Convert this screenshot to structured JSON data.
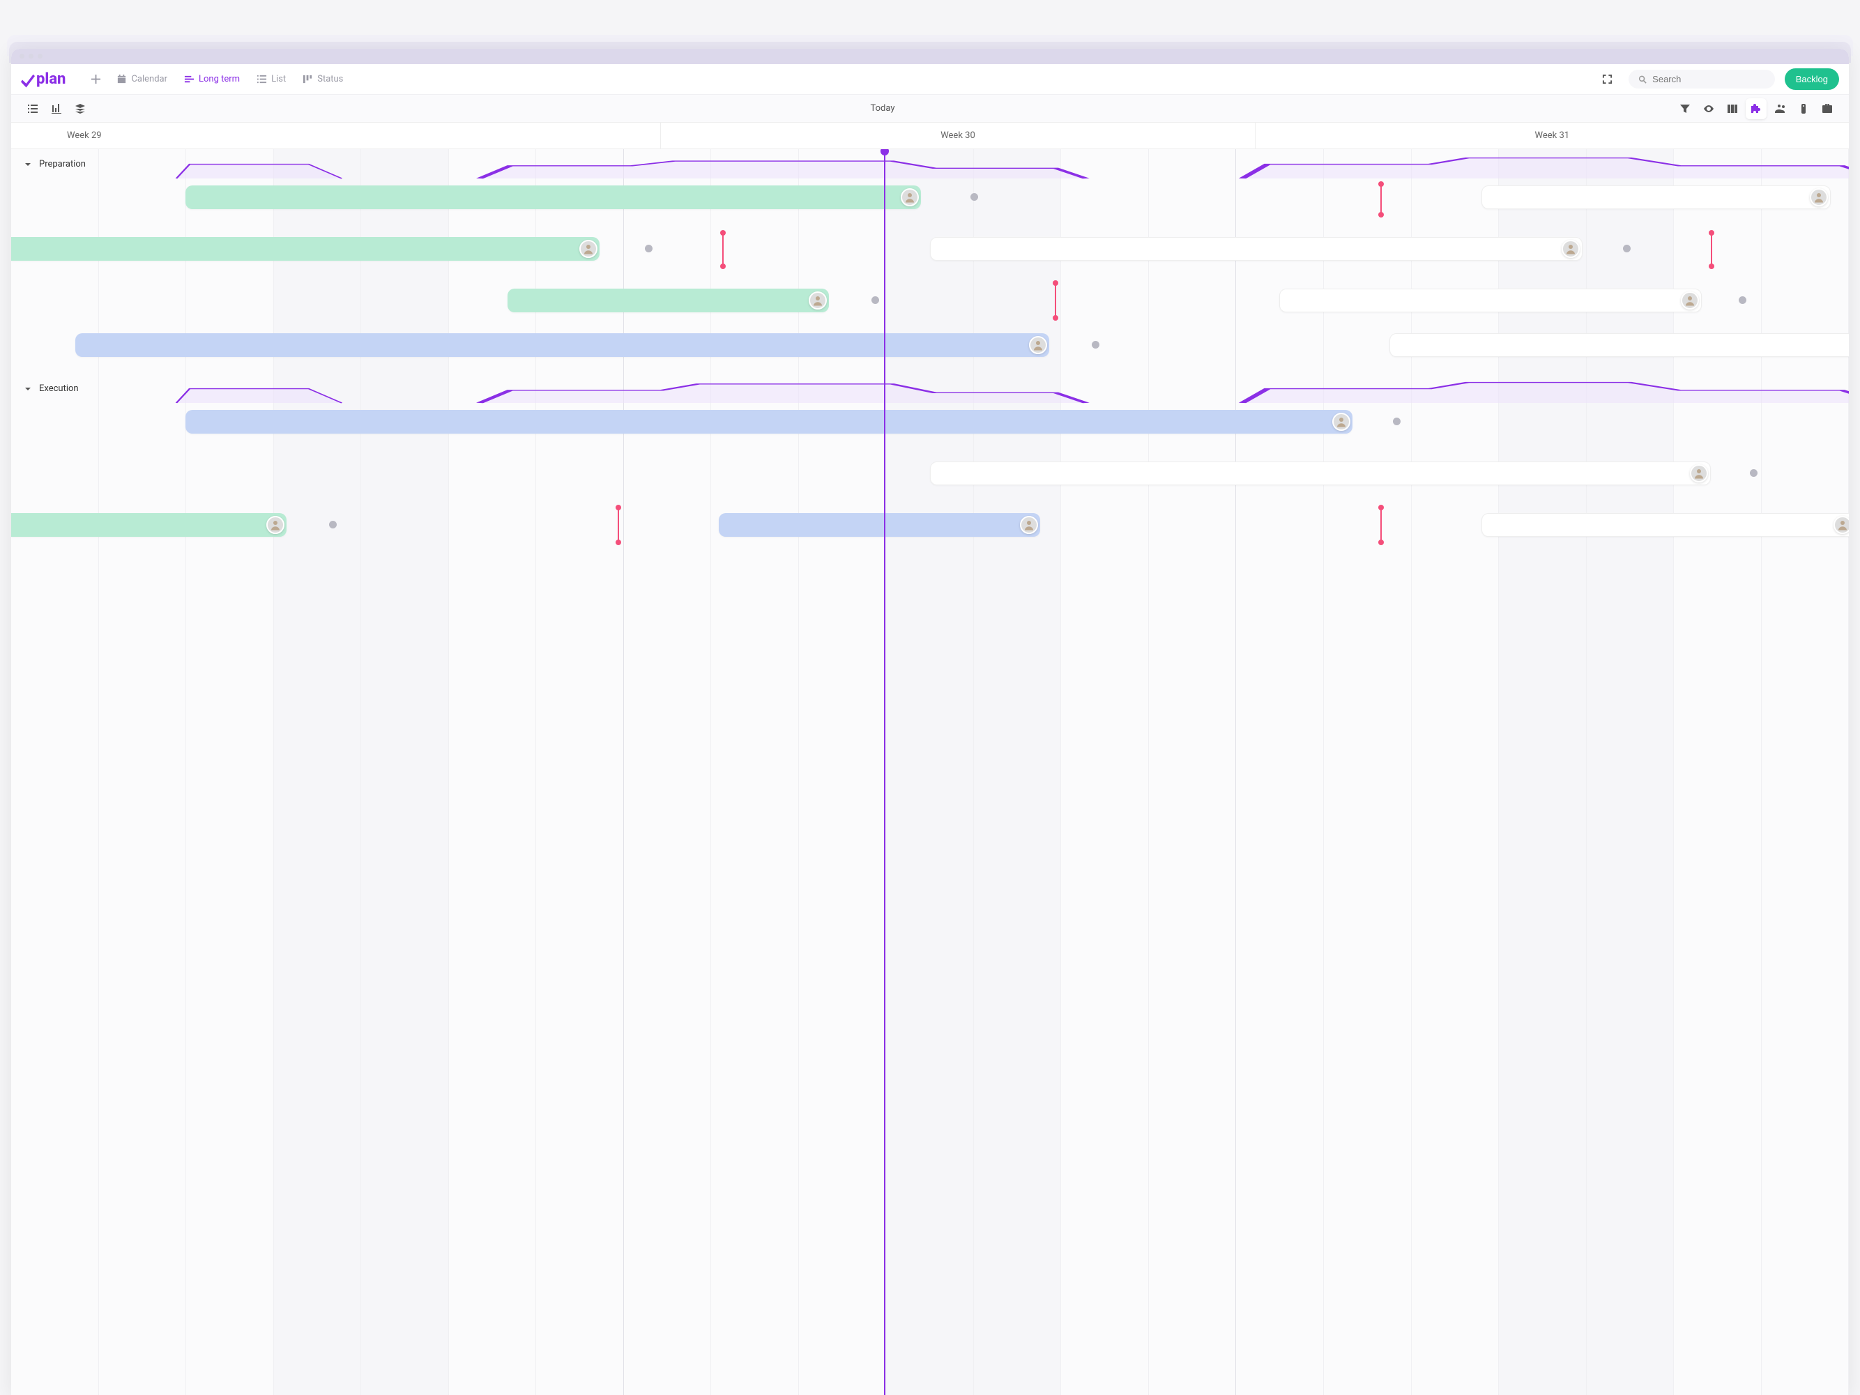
{
  "brand": "plan",
  "nav": {
    "calendar": "Calendar",
    "long_term": "Long term",
    "list": "List",
    "status": "Status"
  },
  "search": {
    "placeholder": "Search"
  },
  "backlog_label": "Backlog",
  "toolbar": {
    "today": "Today"
  },
  "weeks": [
    "Week 29",
    "Week 30",
    "Week 31"
  ],
  "groups": {
    "preparation": "Preparation",
    "execution": "Execution"
  },
  "colors": {
    "brand": "#8b2fe6",
    "accent": "#1fc18e",
    "bar_green": "#b8ebd4",
    "bar_blue": "#c4d4f5",
    "marker": "#f44e7a"
  }
}
